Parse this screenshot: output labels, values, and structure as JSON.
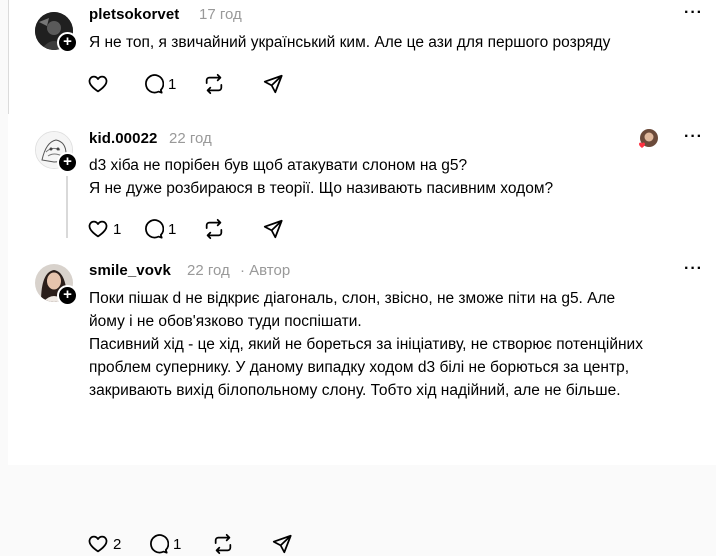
{
  "posts": [
    {
      "username": "pletsokorvet",
      "time": "17 год",
      "author_tag": "",
      "text": [
        "Я не топ, я звичайний український ким. Але це ази для першого розряду"
      ],
      "likes": "",
      "replies": "1"
    },
    {
      "username": "kid.00022",
      "time": "22 год",
      "author_tag": "",
      "text": [
        "d3 хіба не порібен був щоб атакувати слоном на g5?",
        "Я не дуже розбираюся в теорії. Що називають пасивним ходом?"
      ],
      "likes": "1",
      "replies": "1"
    },
    {
      "username": "smile_vovk",
      "time": "22 год",
      "author_tag": "· Автор",
      "text": [
        "Поки пішак d не відкриє діагональ, слон, звісно, не зможе піти на g5. Але",
        "йому і не обов'язково туди поспішати.",
        "Пасивний хід - це хід, який не бореться за ініціативу, не створює потенційних",
        "проблем супернику. У даному випадку ходом d3 білі не борються за центр,",
        "закривають вихід білопольному слону. Тобто хід надійний, але не більше."
      ],
      "likes": "2",
      "replies": "1"
    }
  ],
  "more_label": "···",
  "icons": {
    "like": "heart-icon",
    "reply": "comment-icon",
    "repost": "repost-icon",
    "share": "share-icon",
    "liked_by": "liked-by-author-avatar"
  }
}
